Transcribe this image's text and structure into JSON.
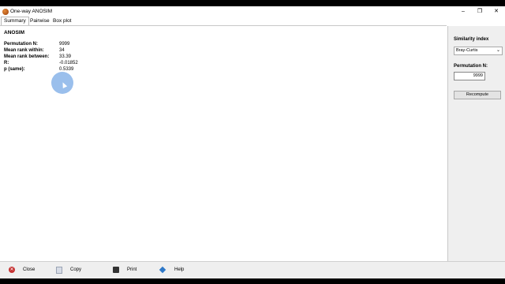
{
  "window": {
    "title": "One-way ANOSIM"
  },
  "tabs": [
    {
      "label": "Summary"
    },
    {
      "label": "Pairwise"
    },
    {
      "label": "Box plot"
    }
  ],
  "summary": {
    "heading": "ANOSIM",
    "rows": [
      {
        "label": "Permutation N:",
        "value": "9999"
      },
      {
        "label": "Mean rank within:",
        "value": "34"
      },
      {
        "label": "Mean rank between:",
        "value": "33.39"
      },
      {
        "label": "R:",
        "value": "-0.01852"
      },
      {
        "label": "p (same):",
        "value": "0.5339"
      }
    ]
  },
  "side": {
    "similarity_label": "Similarity index",
    "similarity_value": "Bray-Curtis",
    "permutation_label": "Permutation N:",
    "permutation_value": "9999",
    "recompute_label": "Recompute"
  },
  "bottom": {
    "close": "Close",
    "copy": "Copy",
    "print": "Print",
    "help": "Help"
  },
  "colors": {
    "accent": "#2e78c8",
    "close_red": "#c63232"
  }
}
